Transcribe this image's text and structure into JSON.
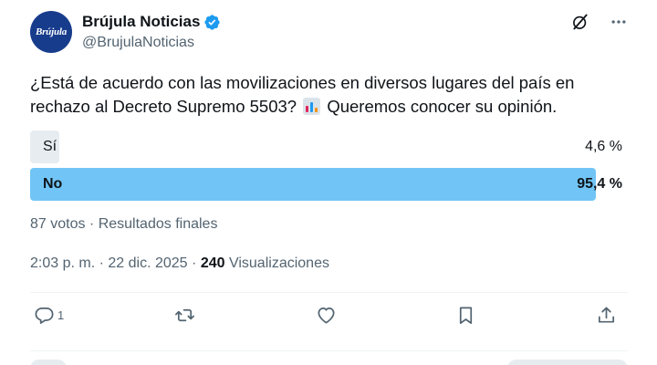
{
  "author": {
    "avatar_text": "Brújula",
    "display_name": "Brújula Noticias",
    "handle": "@BrujulaNoticias",
    "verified": true,
    "avatar_color": "#173c8c",
    "verified_color": "#1d9bf0"
  },
  "tweet": {
    "text_before": "¿Está de acuerdo con las movilizaciones en diversos lugares del país en rechazo al Decreto Supremo 5503? ",
    "emoji": "bar-chart-emoji",
    "text_after": " Queremos conocer su opinión."
  },
  "poll": {
    "options": [
      {
        "label": "Sí",
        "percent_text": "4,6 %",
        "fraction": 0.046,
        "winner": false
      },
      {
        "label": "No",
        "percent_text": "95,4 %",
        "fraction": 0.954,
        "winner": true
      }
    ],
    "meta": "87 votos · Resultados finales",
    "winner_color": "#71c5f6",
    "loser_color": "#e7ecf0"
  },
  "meta": {
    "time": "2:03 p. m.",
    "date": "22 dic. 2025",
    "views_count": "240",
    "views_label": "Visualizaciones"
  },
  "actions": {
    "reply_count": "1",
    "icons": [
      "reply-icon",
      "retweet-icon",
      "like-icon",
      "bookmark-icon",
      "share-icon"
    ]
  },
  "top_icons": [
    "grok-icon",
    "more-options-icon"
  ]
}
